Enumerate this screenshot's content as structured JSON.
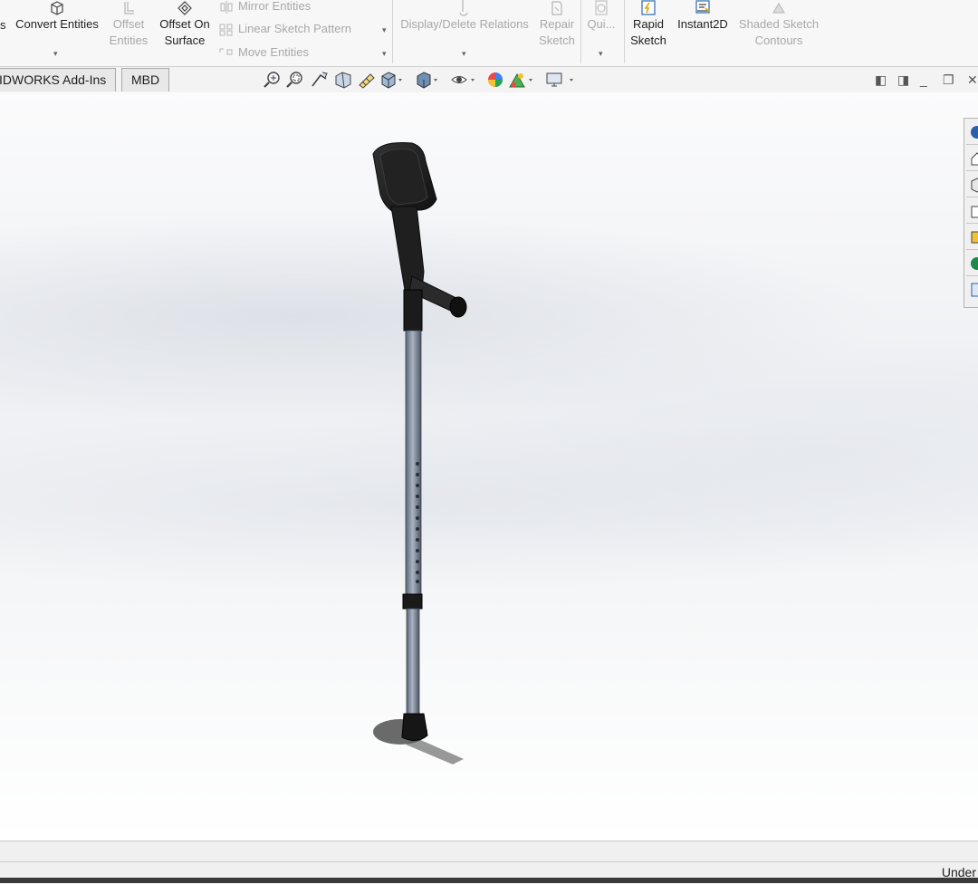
{
  "ribbon": {
    "partial_label": "s",
    "convert_entities": "Convert Entities",
    "offset_entities_1": "Offset",
    "offset_entities_2": "Entities",
    "offset_on_surface_1": "Offset On",
    "offset_on_surface_2": "Surface",
    "mirror_entities": "Mirror Entities",
    "linear_pattern": "Linear Sketch Pattern",
    "move_entities": "Move Entities",
    "display_relations": "Display/Delete Relations",
    "repair_sketch_1": "Repair",
    "repair_sketch_2": "Sketch",
    "quick_snaps": "Qui...",
    "rapid_sketch_1": "Rapid",
    "rapid_sketch_2": "Sketch",
    "instant2d": "Instant2D",
    "shaded_contours_1": "Shaded Sketch",
    "shaded_contours_2": "Contours"
  },
  "tabs": [
    "IDWORKS Add-Ins",
    "MBD"
  ],
  "status": {
    "text": "Under"
  },
  "colors": {
    "ribbon_bg": "#f7f7f7",
    "disabled_text": "#a8a8a8",
    "viewport_bg": "#eef0f3"
  },
  "icons": [
    "zoom-to-fit-icon",
    "zoom-area-icon",
    "previous-view-icon",
    "section-view-icon",
    "dynamic-annotation-icon",
    "view-orientation-icon",
    "display-style-icon",
    "hide-show-items-icon",
    "edit-appearance-icon",
    "apply-scene-icon",
    "view-settings-icon"
  ]
}
